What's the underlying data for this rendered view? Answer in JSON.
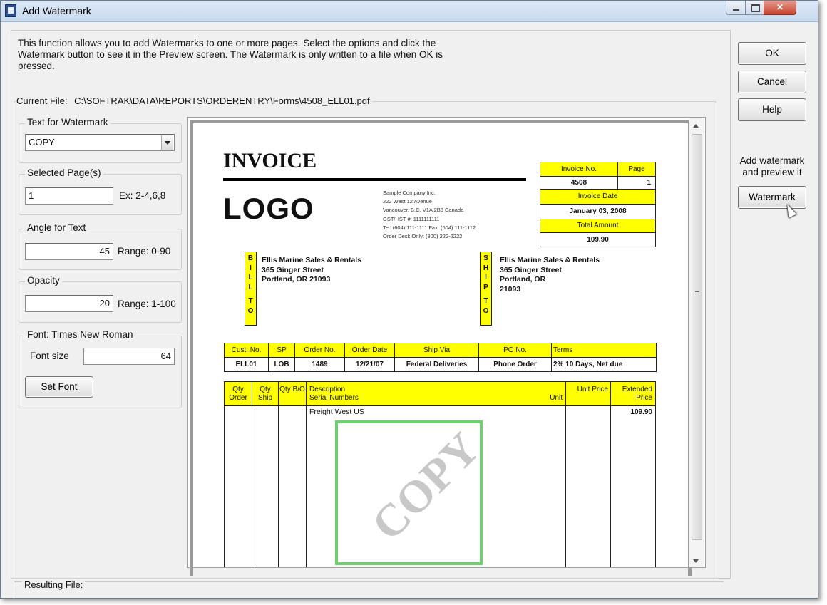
{
  "window": {
    "title": "Add Watermark",
    "minimize": "",
    "maximize": "",
    "close": "✕"
  },
  "description": "This function allows you to add Watermarks to one or more pages.  Select the options and click the Watermark button to see it in the Preview screen.  The Watermark is only written to a file when OK is pressed.",
  "current_file": {
    "label": "Current File:",
    "path": "C:\\SOFTRAK\\DATA\\REPORTS\\ORDERENTRY\\Forms\\4508_ELL01.pdf"
  },
  "text_for_watermark": {
    "label": "Text for Watermark",
    "value": "COPY"
  },
  "selected_pages": {
    "label": "Selected Page(s)",
    "value": "1",
    "hint": "Ex: 2-4,6,8"
  },
  "angle": {
    "label": "Angle for Text",
    "value": "45",
    "hint": "Range: 0-90"
  },
  "opacity": {
    "label": "Opacity",
    "value": "20",
    "hint": "Range: 1-100"
  },
  "font": {
    "label": "Font: Times New Roman",
    "size_label": "Font size",
    "size_value": "64",
    "set_font_button": "Set Font"
  },
  "buttons": {
    "ok": "OK",
    "cancel": "Cancel",
    "help": "Help",
    "watermark_hint": "Add watermark and preview it",
    "watermark": "Watermark"
  },
  "resulting_file": {
    "label": "Resulting File:"
  },
  "invoice": {
    "title": "INVOICE",
    "logo": "LOGO",
    "company_lines": [
      "Sample Company Inc.",
      "222 West 12 Avenue",
      "Vancouver, B.C. V1A 2B3 Canada",
      "GST/HST #: 1111111111",
      "Tel: (604) 111-1111 Fax: (604) 111-1112",
      "Order Desk Only: (800) 222-2222"
    ],
    "invoice_no_label": "Invoice No.",
    "invoice_no": "4508",
    "page_label": "Page",
    "page": "1",
    "invoice_date_label": "Invoice Date",
    "invoice_date": "January 03, 2008",
    "total_amount_label": "Total Amount",
    "total_amount": "109.90",
    "bill_to_letters": [
      "B",
      "I",
      "L",
      "L",
      "",
      "T",
      "O"
    ],
    "ship_to_letters": [
      "S",
      "H",
      "I",
      "P",
      "",
      "T",
      "O"
    ],
    "bill_to_lines": [
      "Ellis Marine Sales & Rentals",
      "365 Ginger Street",
      "Portland, OR  21093"
    ],
    "ship_to_lines": [
      "Ellis Marine Sales & Rentals",
      "365 Ginger Street",
      "Portland, OR",
      "21093"
    ],
    "order_headers": [
      "Cust. No.",
      "SP",
      "Order No.",
      "Order Date",
      "Ship Via",
      "PO No.",
      "Terms"
    ],
    "order_values": [
      "ELL01",
      "LOB",
      "1489",
      "12/21/07",
      "Federal Deliveries",
      "Phone Order",
      "2% 10 Days, Net due"
    ],
    "item_headers": {
      "qty_order": "Qty Order",
      "qty_ship": "Qty Ship",
      "qty_bo": "Qty B/O",
      "description": "Description",
      "serial": "Serial Numbers",
      "unit": "Unit",
      "unit_price": "Unit Price",
      "extended_price": "Extended Price"
    },
    "item_description": "Freight West US",
    "item_extended": "109.90",
    "watermark_text": "COPY"
  }
}
